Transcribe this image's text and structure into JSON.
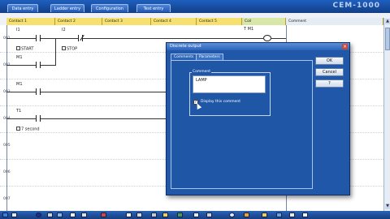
{
  "tabs": [
    "Data entry",
    "Ladder entry",
    "Configuration",
    "Test entry"
  ],
  "brand": "CEM-1000",
  "header": {
    "contacts": [
      "Contact 1",
      "Contact 2",
      "Contact 3",
      "Contact 4",
      "Contact 5"
    ],
    "coil": "Coil",
    "comment": "Comment"
  },
  "rows": [
    "001",
    "002",
    "003",
    "004",
    "005",
    "006",
    "007"
  ],
  "ladder": {
    "r1_contact1": "I1",
    "r1_contact1_sub": "START",
    "r1_contact2": "I2",
    "r1_contact2_sub": "STOP",
    "r1_coil": "T M1",
    "r1_parallel": "M1",
    "r2_contact": "M1",
    "r3_contact": "T1",
    "r3_contact_sub": "7 second"
  },
  "dialog": {
    "title": "Discrete output",
    "tabs": [
      "Comments",
      "Parameters"
    ],
    "group_title": "Comment",
    "comment_value": "LAMP",
    "checkbox_label": "Display this comment",
    "checkbox_checked": true,
    "checkmark": "✓",
    "ok": "OK",
    "cancel": "Cancel",
    "help": "?",
    "close": "×"
  },
  "scroll": {
    "up": "▲",
    "down": "▼"
  },
  "colors": {
    "header_contact": "#f5e070",
    "header_coil": "#d8e6a8",
    "dialog_bg": "#2057a8"
  }
}
